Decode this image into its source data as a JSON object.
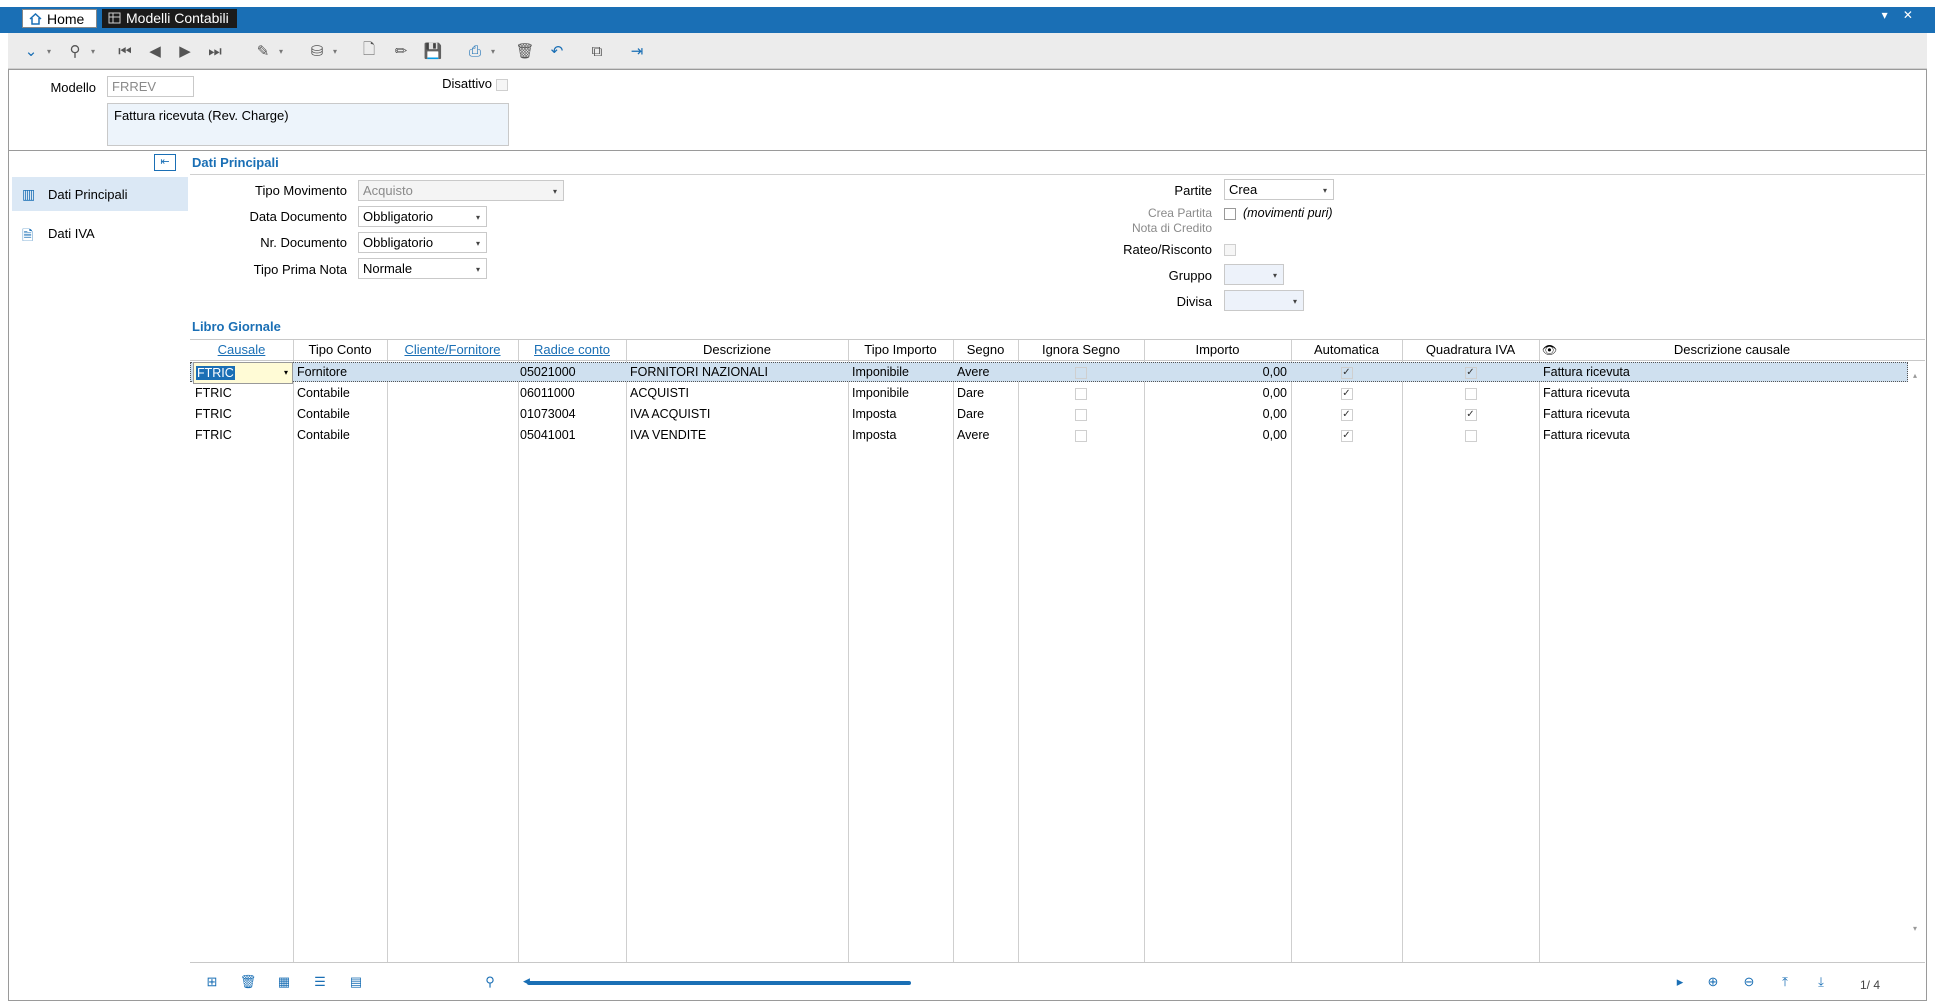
{
  "tabs": [
    {
      "label": "Home"
    },
    {
      "label": "Modelli Contabili"
    }
  ],
  "window_controls": "▾ ✕",
  "toolbar": {
    "icons": [
      "collapse-icon",
      "search-icon",
      "first-record-icon",
      "prev-record-icon",
      "next-record-icon",
      "last-record-icon",
      "wand-icon",
      "database-icon",
      "new-document-icon",
      "edit-icon",
      "save-icon",
      "print-icon",
      "delete-icon",
      "undo-icon",
      "copy-icon",
      "exit-icon"
    ]
  },
  "header": {
    "modello_label": "Modello",
    "modello_value": "FRREV",
    "disattivo_label": "Disattivo",
    "description": "Fattura ricevuta (Rev. Charge)"
  },
  "sidebar": {
    "items": [
      {
        "label": "Dati Principali",
        "active": true
      },
      {
        "label": "Dati IVA",
        "active": false
      }
    ]
  },
  "section_title": "Dati Principali",
  "form": {
    "tipo_movimento_label": "Tipo Movimento",
    "tipo_movimento_value": "Acquisto",
    "data_documento_label": "Data Documento",
    "data_documento_value": "Obbligatorio",
    "nr_documento_label": "Nr. Documento",
    "nr_documento_value": "Obbligatorio",
    "tipo_prima_nota_label": "Tipo Prima Nota",
    "tipo_prima_nota_value": "Normale",
    "partite_label": "Partite",
    "partite_value": "Crea",
    "crea_partita_label_1": "Crea Partita",
    "crea_partita_label_2": "Nota di Credito",
    "crea_partita_note": "(movimenti puri)",
    "rateo_label": "Rateo/Risconto",
    "gruppo_label": "Gruppo",
    "divisa_label": "Divisa"
  },
  "libro_title": "Libro Giornale",
  "grid": {
    "columns": [
      "Causale",
      "Tipo Conto",
      "Cliente/Fornitore",
      "Radice conto",
      "Descrizione",
      "Tipo Importo",
      "Segno",
      "Ignora Segno",
      "Importo",
      "Automatica",
      "Quadratura IVA",
      "Descrizione causale"
    ],
    "rows": [
      {
        "causale": "FTRIC",
        "tipo_conto": "Fornitore",
        "cliente": "",
        "radice": "05021000",
        "descrizione": "FORNITORI NAZIONALI",
        "tipo_importo": "Imponibile",
        "segno": "Avere",
        "ignora": "",
        "importo": "0,00",
        "automatica": "✓",
        "quadratura": "✓",
        "desc_causale": "Fattura ricevuta"
      },
      {
        "causale": "FTRIC",
        "tipo_conto": "Contabile",
        "cliente": "",
        "radice": "06011000",
        "descrizione": "ACQUISTI",
        "tipo_importo": "Imponibile",
        "segno": "Dare",
        "ignora": "",
        "importo": "0,00",
        "automatica": "✓",
        "quadratura": "",
        "desc_causale": "Fattura ricevuta"
      },
      {
        "causale": "FTRIC",
        "tipo_conto": "Contabile",
        "cliente": "",
        "radice": "01073004",
        "descrizione": "IVA ACQUISTI",
        "tipo_importo": "Imposta",
        "segno": "Dare",
        "ignora": "",
        "importo": "0,00",
        "automatica": "✓",
        "quadratura": "✓",
        "desc_causale": "Fattura ricevuta"
      },
      {
        "causale": "FTRIC",
        "tipo_conto": "Contabile",
        "cliente": "",
        "radice": "05041001",
        "descrizione": "IVA VENDITE",
        "tipo_importo": "Imposta",
        "segno": "Avere",
        "ignora": "",
        "importo": "0,00",
        "automatica": "✓",
        "quadratura": "",
        "desc_causale": "Fattura ricevuta"
      }
    ]
  },
  "pager": "1/  4",
  "accent_color": "#1a6fb5"
}
